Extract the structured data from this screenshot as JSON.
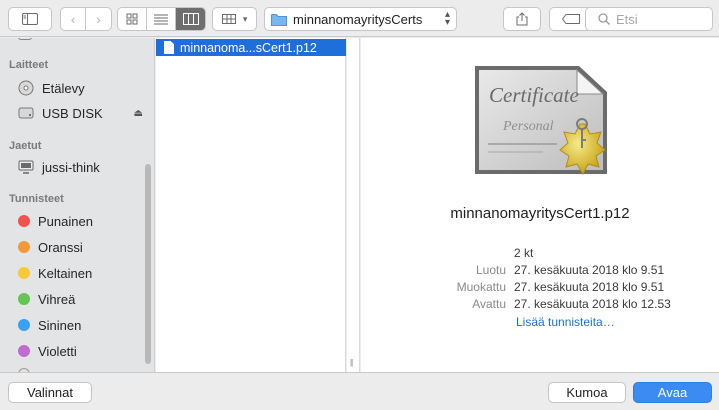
{
  "toolbar": {
    "location": "minnanomayritysCerts",
    "search_placeholder": "Etsi"
  },
  "sidebar": {
    "devices_header": "Laitteet",
    "devices": [
      {
        "label": "Etälevy",
        "icon": "disc-icon"
      },
      {
        "label": "USB DISK",
        "icon": "drive-icon"
      }
    ],
    "shared_header": "Jaetut",
    "shared": [
      {
        "label": "jussi-think",
        "icon": "computer-icon"
      }
    ],
    "tags_header": "Tunnisteet",
    "tags": [
      {
        "label": "Punainen",
        "color": "#f0524f"
      },
      {
        "label": "Oranssi",
        "color": "#f2993a"
      },
      {
        "label": "Keltainen",
        "color": "#f5c937"
      },
      {
        "label": "Vihreä",
        "color": "#62c554"
      },
      {
        "label": "Sininen",
        "color": "#3aa0f0"
      },
      {
        "label": "Violetti",
        "color": "#c06ad6"
      }
    ]
  },
  "browser": {
    "selected_file": "minnanoma...sCert1.p12"
  },
  "preview": {
    "icon_text_1": "Certificate",
    "icon_text_2": "Personal",
    "filename": "minnanomayritysCert1.p12",
    "size": "2 kt",
    "created_label": "Luotu",
    "created_value": "27. kesäkuuta 2018 klo 9.51",
    "modified_label": "Muokattu",
    "modified_value": "27. kesäkuuta 2018 klo 9.51",
    "opened_label": "Avattu",
    "opened_value": "27. kesäkuuta 2018 klo 12.53",
    "add_tags": "Lisää tunnisteita…"
  },
  "buttons": {
    "options": "Valinnat",
    "cancel": "Kumoa",
    "open": "Avaa"
  }
}
